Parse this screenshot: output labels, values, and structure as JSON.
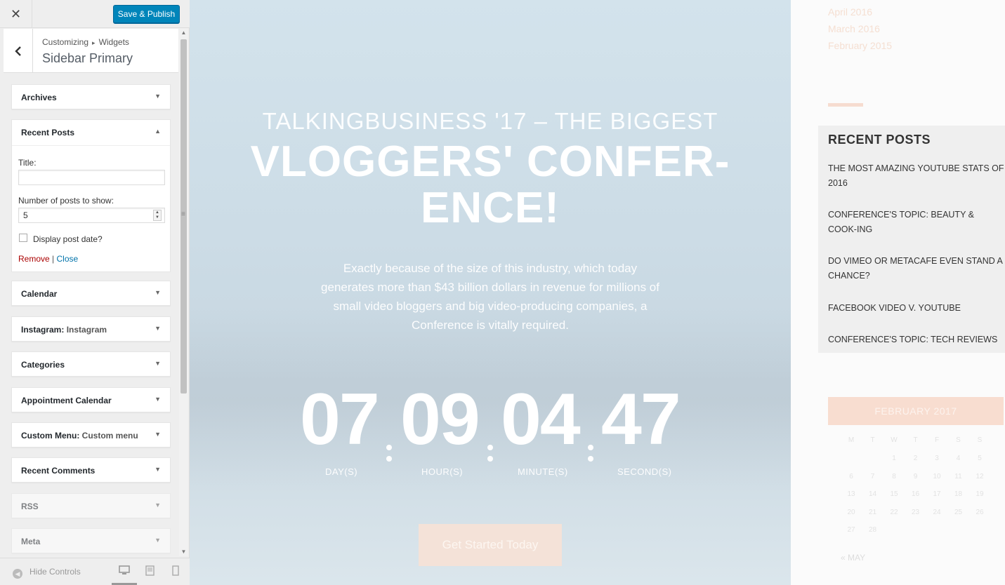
{
  "customizer": {
    "close_icon": "✕",
    "publish_label": "Save & Publish",
    "breadcrumb": {
      "root": "Customizing",
      "separator": "▸",
      "parent": "Widgets"
    },
    "section_title": "Sidebar Primary",
    "widgets_before": [
      {
        "title": "Archives",
        "sub": ""
      }
    ],
    "open_widget": {
      "title": "Recent Posts",
      "title_label": "Title:",
      "title_value": "",
      "count_label": "Number of posts to show:",
      "count_value": "5",
      "date_label": "Display post date?",
      "remove_label": "Remove",
      "divider": "|",
      "close_label": "Close"
    },
    "widgets_after": [
      {
        "title": "Calendar",
        "sub": ""
      },
      {
        "title": "Instagram:",
        "sub": "Instagram"
      },
      {
        "title": "Categories",
        "sub": ""
      },
      {
        "title": "Appointment Calendar",
        "sub": ""
      },
      {
        "title": "Custom Menu:",
        "sub": "Custom menu"
      },
      {
        "title": "Recent Comments",
        "sub": ""
      },
      {
        "title": "RSS",
        "sub": ""
      },
      {
        "title": "Meta",
        "sub": ""
      }
    ],
    "footer": {
      "hide_label": "Hide Controls"
    }
  },
  "hero": {
    "kicker": "TALKINGBUSINESS '17 – THE BIGGEST",
    "title_line1": "VLOGGERS' CONFER-",
    "title_line2": "ENCE!",
    "text": "Exactly because of the size of this industry, which today generates more than $43 billion dollars in revenue for millions of small video bloggers and big video-producing companies, a Conference is vitally required.",
    "countdown": [
      {
        "value": "07",
        "label": "DAY(S)"
      },
      {
        "value": "09",
        "label": "HOUR(S)"
      },
      {
        "value": "04",
        "label": "MINUTE(S)"
      },
      {
        "value": "47",
        "label": "SECOND(S)"
      }
    ],
    "cta_label": "Get Started Today"
  },
  "sidebar": {
    "archives": [
      "April 2016",
      "March 2016",
      "February 2015"
    ],
    "recent_posts_title": "RECENT POSTS",
    "recent_posts": [
      "THE MOST AMAZING YOUTUBE STATS OF 2016",
      "CONFERENCE'S TOPIC: BEAUTY & COOK-ING",
      "DO VIMEO OR METACAFE EVEN STAND A CHANCE?",
      "FACEBOOK VIDEO V. YOUTUBE",
      "CONFERENCE'S TOPIC: TECH REVIEWS"
    ],
    "calendar_title": "FEBRUARY 2017",
    "calendar_weekdays": [
      "M",
      "T",
      "W",
      "T",
      "F",
      "S",
      "S"
    ],
    "calendar_days": [
      "",
      "",
      "1",
      "2",
      "3",
      "4",
      "5",
      "6",
      "7",
      "8",
      "9",
      "10",
      "11",
      "12",
      "13",
      "14",
      "15",
      "16",
      "17",
      "18",
      "19",
      "20",
      "21",
      "22",
      "23",
      "24",
      "25",
      "26",
      "27",
      "28"
    ],
    "calendar_prev": "« MAY"
  },
  "colors": {
    "accent": "#0085ba",
    "remove": "#aa0000",
    "link": "#0073aa",
    "peach": "#f8ddd0"
  }
}
